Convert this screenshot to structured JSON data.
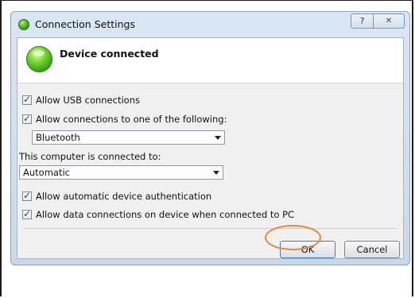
{
  "dialog": {
    "title": "Connection Settings",
    "help_glyph": "?",
    "close_glyph": "✕"
  },
  "header": {
    "status_icon": "connected-status-icon",
    "status_text": "Device connected"
  },
  "options": {
    "allow_usb": {
      "label": "Allow USB connections",
      "checked": true
    },
    "allow_other": {
      "label": "Allow connections to one of the following:",
      "checked": true
    },
    "connection_type": {
      "selected": "Bluetooth"
    },
    "computer_connected_label": "This computer is connected to:",
    "network_type": {
      "selected": "Automatic"
    },
    "allow_auth": {
      "label": "Allow automatic device authentication",
      "checked": true
    },
    "allow_data": {
      "label": "Allow data connections on device when connected to PC",
      "checked": true
    }
  },
  "buttons": {
    "ok": "OK",
    "cancel": "Cancel"
  },
  "colors": {
    "highlight_ring": "#e8873a",
    "status_green": "#55b826"
  }
}
